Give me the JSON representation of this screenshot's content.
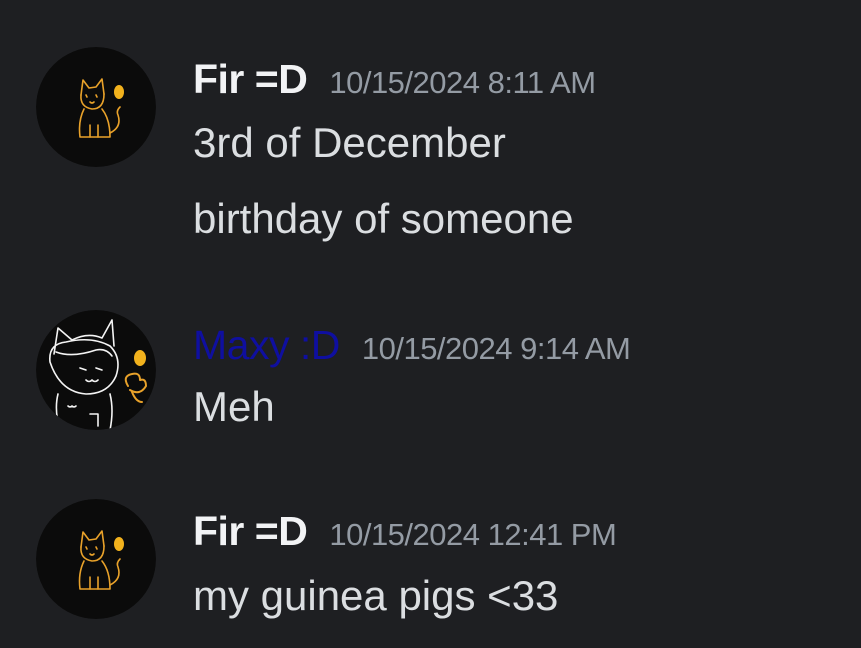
{
  "messages": [
    {
      "author": "Fir =D",
      "timestamp": "10/15/2024 8:11 AM",
      "avatar_icon": "cat-sitting-avatar",
      "lines": [
        "3rd of December",
        "birthday of someone"
      ]
    },
    {
      "author": "Maxy :D",
      "author_color": "#0f0fa0",
      "timestamp": "10/15/2024 9:14 AM",
      "avatar_icon": "cat-waving-avatar",
      "lines": [
        "Meh"
      ]
    },
    {
      "author": "Fir =D",
      "timestamp": "10/15/2024 12:41 PM",
      "avatar_icon": "cat-sitting-avatar",
      "lines": [
        "my guinea pigs <33"
      ]
    }
  ],
  "colors": {
    "background": "#1e1f22",
    "text": "#dbdee1",
    "username": "#f2f3f5",
    "timestamp": "#949ba4",
    "drawing": "#f0a81c"
  }
}
